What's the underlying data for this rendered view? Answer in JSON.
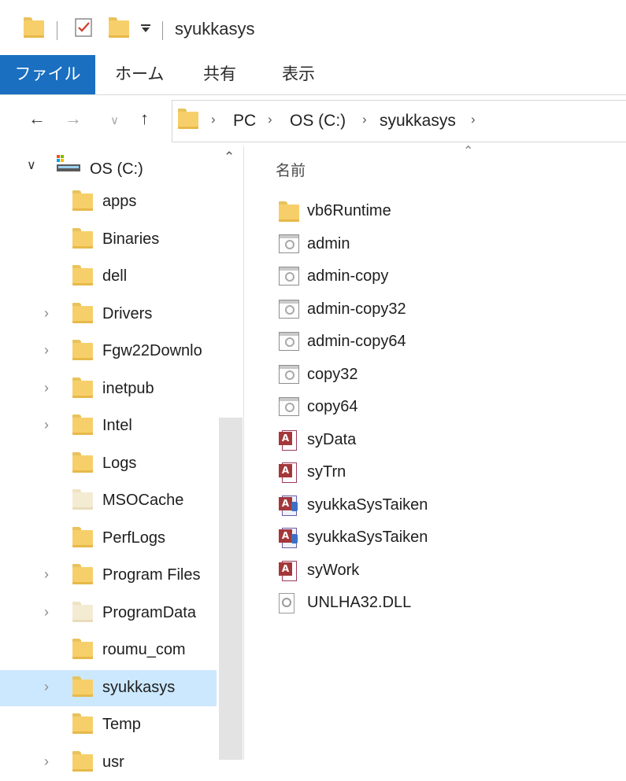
{
  "window": {
    "title": "syukkasys"
  },
  "ribbon": {
    "tabs": [
      "ファイル",
      "ホーム",
      "共有",
      "表示"
    ]
  },
  "address": {
    "crumbs": [
      "PC",
      "OS (C:)",
      "syukkasys"
    ]
  },
  "nav": {
    "drive_label": "OS (C:)",
    "items": [
      {
        "label": "apps",
        "expandable": false,
        "selected": false,
        "pale": false
      },
      {
        "label": "Binaries",
        "expandable": false,
        "selected": false,
        "pale": false
      },
      {
        "label": "dell",
        "expandable": false,
        "selected": false,
        "pale": false
      },
      {
        "label": "Drivers",
        "expandable": true,
        "selected": false,
        "pale": false
      },
      {
        "label": "Fgw22Downlo",
        "expandable": true,
        "selected": false,
        "pale": false
      },
      {
        "label": "inetpub",
        "expandable": true,
        "selected": false,
        "pale": false
      },
      {
        "label": "Intel",
        "expandable": true,
        "selected": false,
        "pale": false
      },
      {
        "label": "Logs",
        "expandable": false,
        "selected": false,
        "pale": false
      },
      {
        "label": "MSOCache",
        "expandable": false,
        "selected": false,
        "pale": true
      },
      {
        "label": "PerfLogs",
        "expandable": false,
        "selected": false,
        "pale": false
      },
      {
        "label": "Program Files",
        "expandable": true,
        "selected": false,
        "pale": false
      },
      {
        "label": "ProgramData",
        "expandable": true,
        "selected": false,
        "pale": true
      },
      {
        "label": "roumu_com",
        "expandable": false,
        "selected": false,
        "pale": false
      },
      {
        "label": "syukkasys",
        "expandable": true,
        "selected": true,
        "pale": false
      },
      {
        "label": "Temp",
        "expandable": false,
        "selected": false,
        "pale": false
      },
      {
        "label": "usr",
        "expandable": true,
        "selected": false,
        "pale": false
      }
    ]
  },
  "content": {
    "column_header": "名前",
    "files": [
      {
        "name": "vb6Runtime",
        "icon": "folder-icon"
      },
      {
        "name": "admin",
        "icon": "application-icon"
      },
      {
        "name": "admin-copy",
        "icon": "application-icon"
      },
      {
        "name": "admin-copy32",
        "icon": "application-icon"
      },
      {
        "name": "admin-copy64",
        "icon": "application-icon"
      },
      {
        "name": "copy32",
        "icon": "application-icon"
      },
      {
        "name": "copy64",
        "icon": "application-icon"
      },
      {
        "name": "syData",
        "icon": "access-database-icon"
      },
      {
        "name": "syTrn",
        "icon": "access-database-icon"
      },
      {
        "name": "syukkaSysTaiken",
        "icon": "access-workgroup-icon"
      },
      {
        "name": "syukkaSysTaiken",
        "icon": "access-workgroup-icon"
      },
      {
        "name": "syWork",
        "icon": "access-database-icon"
      },
      {
        "name": "UNLHA32.DLL",
        "icon": "dll-file-icon"
      }
    ]
  }
}
